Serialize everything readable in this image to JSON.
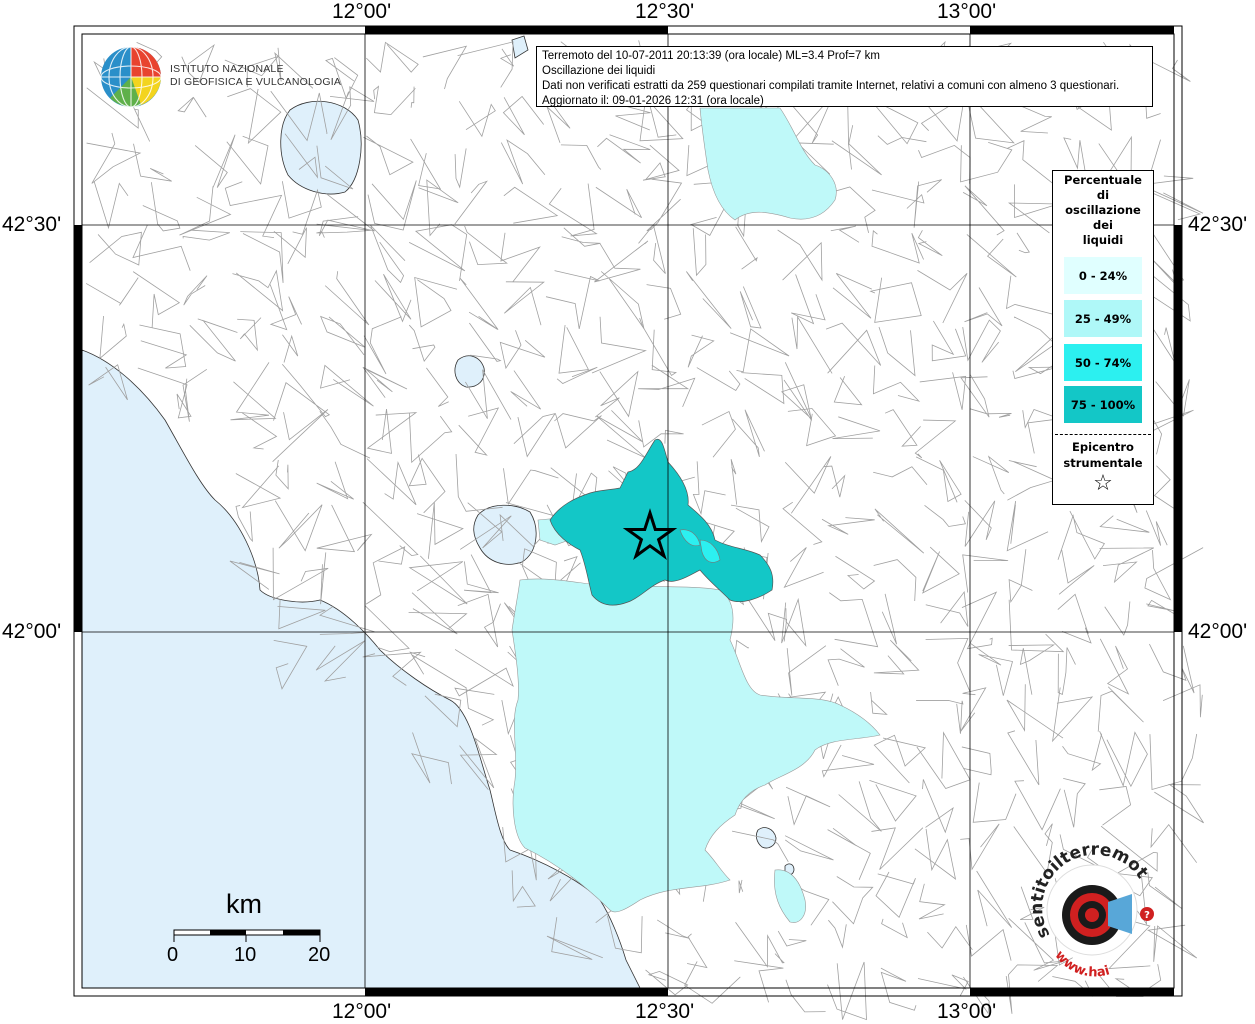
{
  "info": {
    "line1": "Terremoto del 10-07-2011 20:13:39 (ora locale) ML=3.4 Prof=7 km",
    "line2": "Oscillazione dei liquidi",
    "line3": "Dati non verificati estratti da 259 questionari compilati tramite Internet, relativi a comuni con almeno 3 questionari.",
    "line4": "Aggiornato il: 09-01-2026 12:31 (ora locale)"
  },
  "logo": {
    "line1": "ISTITUTO NAZIONALE",
    "line2": "DI GEOFISICA E VULCANOLOGIA"
  },
  "coords": {
    "top": [
      "12°00'",
      "12°30'",
      "13°00'"
    ],
    "bottom": [
      "12°00'",
      "12°30'",
      "13°00'"
    ],
    "left": [
      "42°30'",
      "42°00'"
    ],
    "right": [
      "42°30'",
      "42°00'"
    ]
  },
  "legend": {
    "title": [
      "Percentuale",
      "di",
      "oscillazione",
      "dei",
      "liquidi"
    ],
    "classes": [
      {
        "label": "0 - 24%",
        "color": "#e0ffff"
      },
      {
        "label": "25 - 49%",
        "color": "#aff8f8"
      },
      {
        "label": "50 - 74%",
        "color": "#2cf0f0"
      },
      {
        "label": "75 - 100%",
        "color": "#13c7c7"
      }
    ],
    "epicenter": [
      "Epicentro",
      "strumentale"
    ],
    "star": "☆"
  },
  "scale": {
    "title": "km",
    "labels": [
      "0",
      "10",
      "20"
    ]
  },
  "colors": {
    "sea": "#dff0fb",
    "lake": "#dff0fb",
    "border": "#a0a0a0",
    "class_low": "#bff9f9",
    "class_high": "#13c7c7"
  },
  "watermark": {
    "text": "www.haisentitoilterremoto.it"
  }
}
